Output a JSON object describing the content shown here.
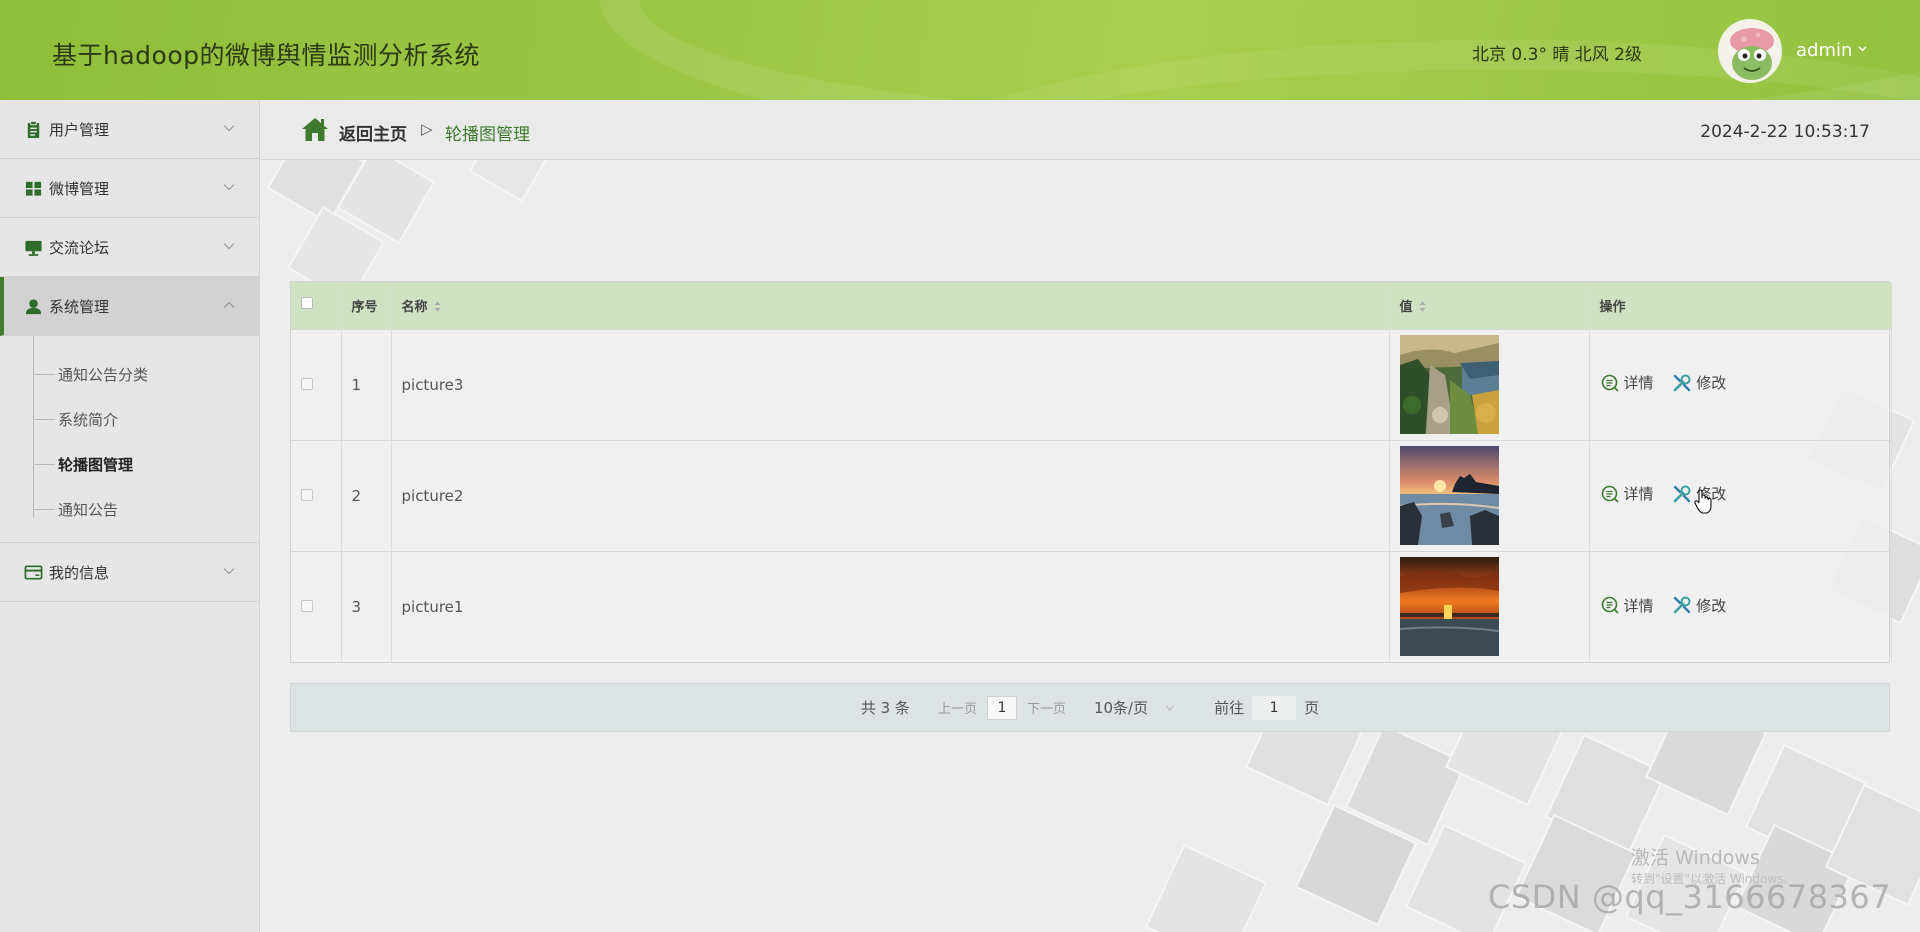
{
  "header": {
    "app_title": "基于hadoop的微博舆情监测分析系统",
    "weather": "北京 0.3° 晴 北风 2级",
    "user": "admin"
  },
  "sidebar": {
    "items": [
      {
        "label": "用户管理",
        "icon": "clipboard-icon"
      },
      {
        "label": "微博管理",
        "icon": "grid-icon"
      },
      {
        "label": "交流论坛",
        "icon": "monitor-icon"
      },
      {
        "label": "系统管理",
        "icon": "user-icon",
        "expanded": true
      },
      {
        "label": "我的信息",
        "icon": "card-icon"
      }
    ],
    "submenu": [
      {
        "label": "通知公告分类"
      },
      {
        "label": "系统简介"
      },
      {
        "label": "轮播图管理",
        "current": true
      },
      {
        "label": "通知公告"
      }
    ]
  },
  "breadcrumb": {
    "home": "返回主页",
    "separator": "▷",
    "current": "轮播图管理"
  },
  "datetime": "2024-2-22 10:53:17",
  "table": {
    "columns": [
      "序号",
      "名称",
      "值",
      "操作"
    ],
    "rows": [
      {
        "index": "1",
        "name": "picture3",
        "image": "forest-cliff-lake"
      },
      {
        "index": "2",
        "name": "picture2",
        "image": "sunset-sea-rocks"
      },
      {
        "index": "3",
        "name": "picture1",
        "image": "orange-sunset-water"
      }
    ],
    "actions": {
      "detail": "详情",
      "edit": "修改"
    }
  },
  "pagination": {
    "total": "共 3 条",
    "prev": "上一页",
    "current_page": "1",
    "next": "下一页",
    "page_size": "10条/页",
    "goto_label": "前往",
    "goto_value": "1",
    "goto_suffix": "页"
  },
  "watermarks": {
    "windows_activate": "激活 Windows",
    "windows_hint": "转到\"设置\"以激活 Windows。",
    "csdn": "CSDN @qq_3166678367"
  },
  "colors": {
    "header_green": "#9bc646",
    "accent_green": "#3f7e2f",
    "table_header": "#cfe3c2"
  }
}
